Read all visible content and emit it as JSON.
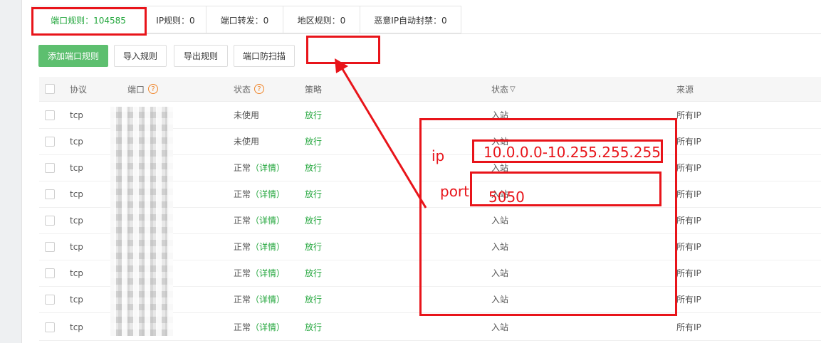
{
  "tabs": [
    {
      "label": "端口规则：104585",
      "active": true
    },
    {
      "label": "IP规则：0",
      "active": false
    },
    {
      "label": "端口转发：0",
      "active": false
    },
    {
      "label": "地区规则：0",
      "active": false
    },
    {
      "label": "恶意IP自动封禁：0",
      "active": false
    }
  ],
  "toolbar": {
    "add": "添加端口规则",
    "import": "导入规则",
    "export": "导出规则",
    "scan": "端口防扫描"
  },
  "table": {
    "headers": {
      "protocol": "协议",
      "port": "端口",
      "status": "状态",
      "policy": "策略",
      "direction": "状态",
      "source": "来源"
    },
    "help_glyph": "?",
    "sort_glyph": "▽",
    "rows": [
      {
        "protocol": "tcp",
        "port": "20",
        "status": "未使用",
        "detail": "",
        "policy": "放行",
        "direction": "入站",
        "source": "所有IP"
      },
      {
        "protocol": "tcp",
        "port": "",
        "status": "未使用",
        "detail": "",
        "policy": "放行",
        "direction": "入站",
        "source": "所有IP"
      },
      {
        "protocol": "tcp",
        "port": "",
        "status": "正常",
        "detail": "（详情）",
        "policy": "放行",
        "direction": "入站",
        "source": "所有IP"
      },
      {
        "protocol": "tcp",
        "port": "",
        "status": "正常",
        "detail": "（详情）",
        "policy": "放行",
        "direction": "入站",
        "source": "所有IP"
      },
      {
        "protocol": "tcp",
        "port": "",
        "status": "正常",
        "detail": "（详情）",
        "policy": "放行",
        "direction": "入站",
        "source": "所有IP"
      },
      {
        "protocol": "tcp",
        "port": "",
        "status": "正常",
        "detail": "（详情）",
        "policy": "放行",
        "direction": "入站",
        "source": "所有IP"
      },
      {
        "protocol": "tcp",
        "port": "",
        "status": "正常",
        "detail": "（详情）",
        "policy": "放行",
        "direction": "入站",
        "source": "所有IP"
      },
      {
        "protocol": "tcp",
        "port": "",
        "status": "正常",
        "detail": "（详情）",
        "policy": "放行",
        "direction": "入站",
        "source": "所有IP"
      },
      {
        "protocol": "tcp",
        "port": "",
        "status": "正常",
        "detail": "（详情）",
        "policy": "放行",
        "direction": "入站",
        "source": "所有IP"
      }
    ]
  },
  "annotation": {
    "ip_label": "ip",
    "ip_value": "10.0.0.0-10.255.255.255",
    "port_label": "port",
    "port_value": "5050"
  },
  "colors": {
    "accent_green": "#20a53a",
    "primary_button": "#5dbf6f",
    "help_orange": "#f0862b",
    "annotation_red": "#e8141a"
  }
}
